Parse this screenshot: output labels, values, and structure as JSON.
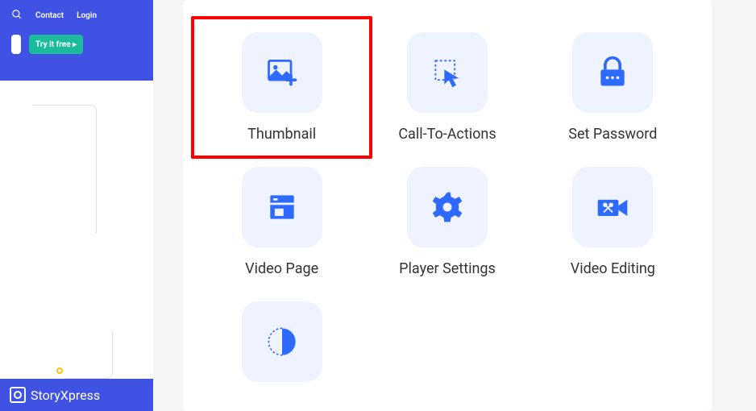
{
  "leftPanel": {
    "nav": {
      "contact": "Contact",
      "login": "Login"
    },
    "cta": "Try it free ▸",
    "brand": "StoryXpress"
  },
  "tiles": [
    {
      "label": "Thumbnail"
    },
    {
      "label": "Call-To-Actions"
    },
    {
      "label": "Set Password"
    },
    {
      "label": "Video Page"
    },
    {
      "label": "Player Settings"
    },
    {
      "label": "Video Editing"
    },
    {
      "label": ""
    }
  ],
  "colors": {
    "accent": "#2f6aff",
    "highlight": "#ff0000",
    "brand": "#3f52e3"
  }
}
